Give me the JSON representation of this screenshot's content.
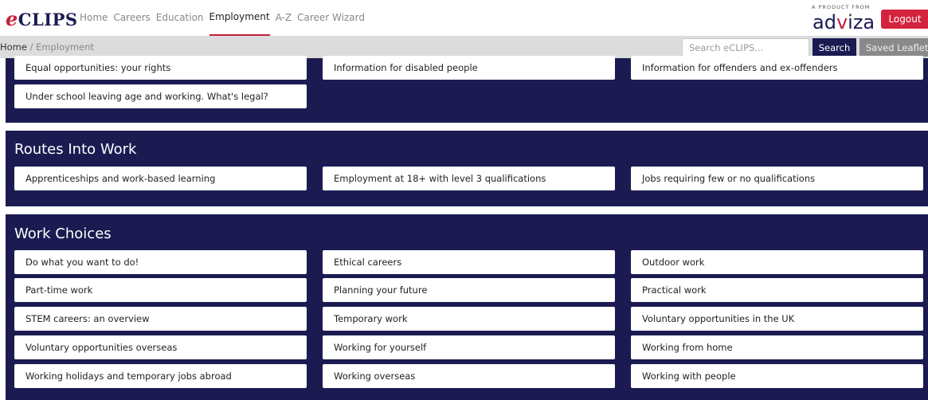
{
  "header": {
    "logo_text": "CLIPS",
    "logo_e": "e",
    "nav": [
      "Home",
      "Careers",
      "Education",
      "Employment",
      "A-Z",
      "Career Wizard"
    ],
    "active_nav": "Employment",
    "product_from": "A PRODUCT FROM",
    "brand": "adviza",
    "logout_label": "Logout"
  },
  "breadcrumb": {
    "home": "Home",
    "separator": "/",
    "current": "Employment"
  },
  "search": {
    "placeholder": "Search eCLIPS...",
    "button_label": "Search",
    "saved_label": "Saved Leaflets"
  },
  "sections": [
    {
      "title": "",
      "items": [
        "Equal opportunities: your rights",
        "Information for disabled people",
        "Information for offenders and ex-offenders",
        "Under school leaving age and working. What's legal?"
      ]
    },
    {
      "title": "Routes Into Work",
      "items": [
        "Apprenticeships and work-based learning",
        "Employment at 18+ with level 3 qualifications",
        "Jobs requiring few or no qualifications"
      ]
    },
    {
      "title": "Work Choices",
      "items": [
        "Do what you want to do!",
        "Ethical careers",
        "Outdoor work",
        "Part-time work",
        "Planning your future",
        "Practical work",
        "STEM careers: an overview",
        "Temporary work",
        "Voluntary opportunities in the UK",
        "Voluntary opportunities overseas",
        "Working for yourself",
        "Working from home",
        "Working holidays and temporary jobs abroad",
        "Working overseas",
        "Working with people"
      ]
    }
  ],
  "colors": {
    "navy": "#1b1b52",
    "accent_red": "#d4233d",
    "breadcrumb_bg": "#dcdcdc"
  }
}
